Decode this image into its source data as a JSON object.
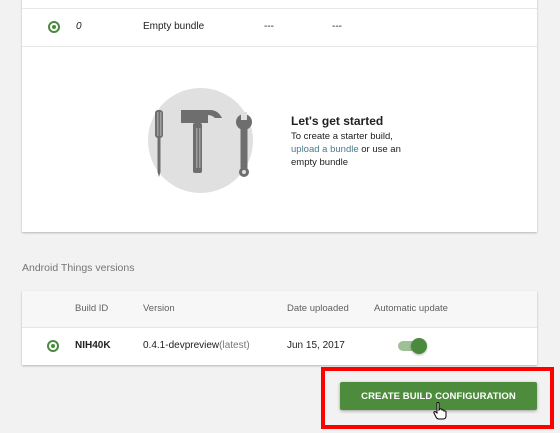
{
  "bundle_row": {
    "version": "0",
    "name": "Empty bundle",
    "col3": "---",
    "col4": "---"
  },
  "empty_state": {
    "title": "Let's get started",
    "line1": "To create a starter build,",
    "link": "upload a bundle",
    "line2_suffix": " or use an",
    "line3": "empty bundle",
    "icons": [
      "screwdriver-icon",
      "hammer-icon",
      "wrench-icon"
    ]
  },
  "android_things": {
    "section_title": "Android Things versions",
    "columns": [
      "Build ID",
      "Version",
      "Date uploaded",
      "Automatic update"
    ],
    "rows": [
      {
        "build_id": "NIH40K",
        "version": "0.4.1-devpreview",
        "version_tag": "(latest)",
        "date": "Jun 15, 2017",
        "auto_update": true
      }
    ]
  },
  "cta": {
    "label": "CREATE BUILD CONFIGURATION"
  },
  "colors": {
    "accent": "#4e8c3d",
    "highlight": "#ff0000",
    "link": "#4b7a8a"
  }
}
